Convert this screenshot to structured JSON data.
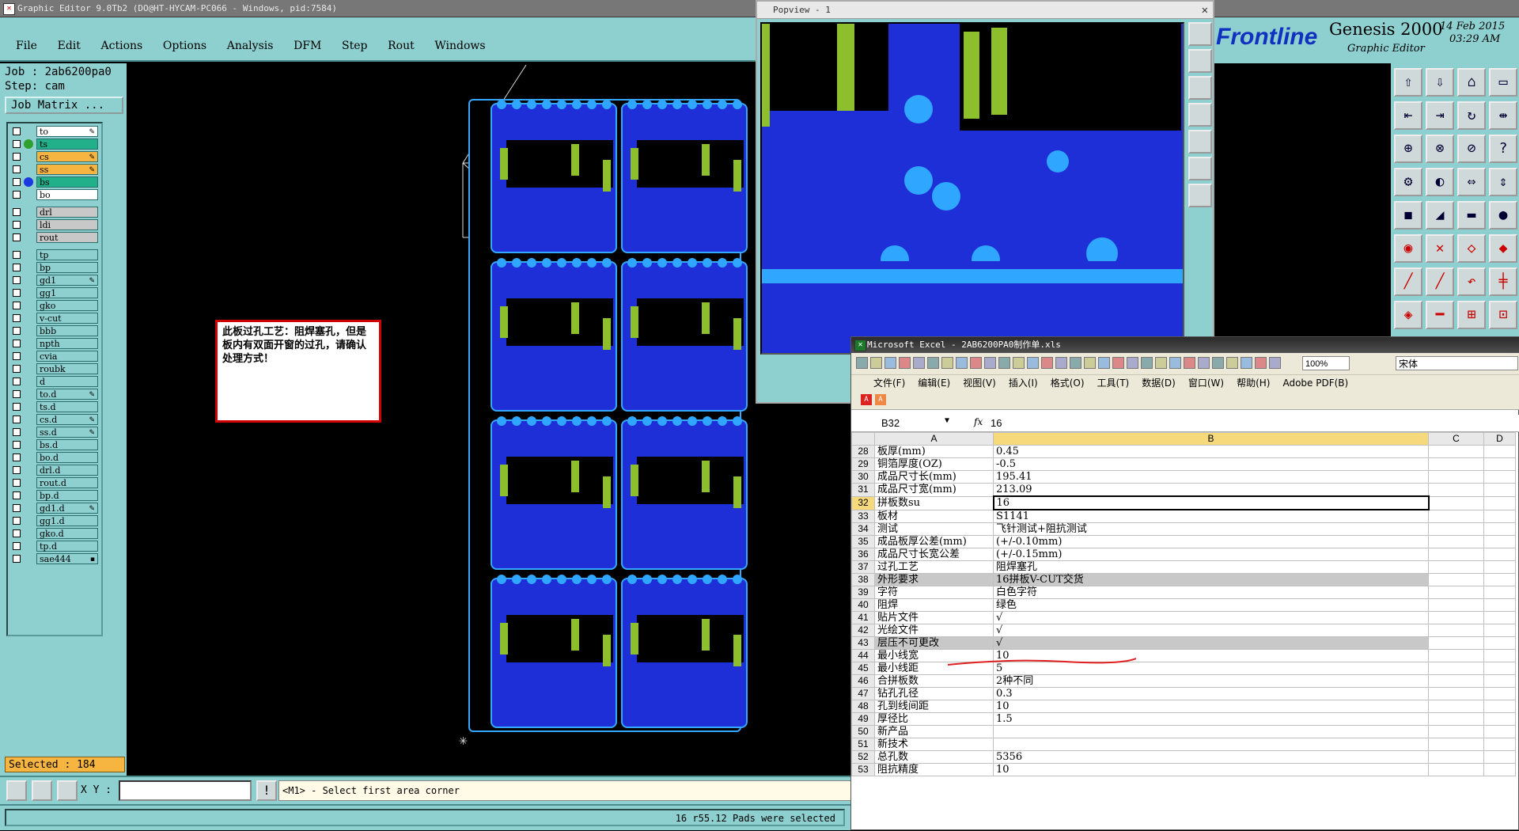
{
  "editor": {
    "title": "Graphic Editor 9.0Tb2 (DO@HT-HYCAM-PC066 - Windows, pid:7584)",
    "menu": [
      "File",
      "Edit",
      "Actions",
      "Options",
      "Analysis",
      "DFM",
      "Step",
      "Rout",
      "Windows"
    ],
    "job_label": "Job : 2ab6200pa0",
    "step_label": "Step: cam",
    "job_matrix_button": "Job Matrix ...",
    "layers": [
      {
        "name": "to",
        "color": "#ffffff",
        "dot": "",
        "mark": "✎"
      },
      {
        "name": "ts",
        "color": "#22b08a",
        "dot": "#2fa02f",
        "mark": ""
      },
      {
        "name": "cs",
        "color": "#f6b440",
        "dot": "",
        "mark": "✎"
      },
      {
        "name": "ss",
        "color": "#f6b440",
        "dot": "",
        "mark": "✎"
      },
      {
        "name": "bs",
        "color": "#22b08a",
        "dot": "#1a3ae0",
        "mark": ""
      },
      {
        "name": "bo",
        "color": "#ffffff",
        "dot": "",
        "mark": ""
      },
      {
        "name": "drl",
        "color": "#c8c8c8",
        "dot": "",
        "mark": "",
        "gap": true
      },
      {
        "name": "ldi",
        "color": "#c8c8c8",
        "dot": "",
        "mark": ""
      },
      {
        "name": "rout",
        "color": "#c8c8c8",
        "dot": "",
        "mark": ""
      },
      {
        "name": "tp",
        "color": "#8ecfcf",
        "dot": "",
        "mark": "",
        "gap": true
      },
      {
        "name": "bp",
        "color": "#8ecfcf",
        "dot": "",
        "mark": ""
      },
      {
        "name": "gd1",
        "color": "#8ecfcf",
        "dot": "",
        "mark": "✎"
      },
      {
        "name": "gg1",
        "color": "#8ecfcf",
        "dot": "",
        "mark": ""
      },
      {
        "name": "gko",
        "color": "#8ecfcf",
        "dot": "",
        "mark": ""
      },
      {
        "name": "v-cut",
        "color": "#8ecfcf",
        "dot": "",
        "mark": ""
      },
      {
        "name": "bbb",
        "color": "#8ecfcf",
        "dot": "",
        "mark": ""
      },
      {
        "name": "npth",
        "color": "#8ecfcf",
        "dot": "",
        "mark": ""
      },
      {
        "name": "cvia",
        "color": "#8ecfcf",
        "dot": "",
        "mark": ""
      },
      {
        "name": "roubk",
        "color": "#8ecfcf",
        "dot": "",
        "mark": ""
      },
      {
        "name": "d",
        "color": "#8ecfcf",
        "dot": "",
        "mark": ""
      },
      {
        "name": "to.d",
        "color": "#8ecfcf",
        "dot": "",
        "mark": "✎"
      },
      {
        "name": "ts.d",
        "color": "#8ecfcf",
        "dot": "",
        "mark": ""
      },
      {
        "name": "cs.d",
        "color": "#8ecfcf",
        "dot": "",
        "mark": "✎"
      },
      {
        "name": "ss.d",
        "color": "#8ecfcf",
        "dot": "",
        "mark": "✎"
      },
      {
        "name": "bs.d",
        "color": "#8ecfcf",
        "dot": "",
        "mark": ""
      },
      {
        "name": "bo.d",
        "color": "#8ecfcf",
        "dot": "",
        "mark": ""
      },
      {
        "name": "drl.d",
        "color": "#8ecfcf",
        "dot": "",
        "mark": ""
      },
      {
        "name": "rout.d",
        "color": "#8ecfcf",
        "dot": "",
        "mark": ""
      },
      {
        "name": "bp.d",
        "color": "#8ecfcf",
        "dot": "",
        "mark": ""
      },
      {
        "name": "gd1.d",
        "color": "#8ecfcf",
        "dot": "",
        "mark": "✎"
      },
      {
        "name": "gg1.d",
        "color": "#8ecfcf",
        "dot": "",
        "mark": ""
      },
      {
        "name": "gko.d",
        "color": "#8ecfcf",
        "dot": "",
        "mark": ""
      },
      {
        "name": "tp.d",
        "color": "#8ecfcf",
        "dot": "",
        "mark": ""
      },
      {
        "name": "sae444",
        "color": "#8ecfcf",
        "dot": "",
        "mark": "▪"
      }
    ],
    "selected_label": "Selected : 184",
    "xy_label": "X Y :",
    "xy_value": "",
    "prompt": "<M1> - Select first area corner",
    "status": "16 r55.12 Pads were selected",
    "note": "此板过孔工艺：阻焊塞孔，但是板内有双面开窗的过孔，请确认处理方式！"
  },
  "popview": {
    "title": "Popview - 1",
    "close": "✕"
  },
  "brand": {
    "logo": "Frontline",
    "product": "Genesis 2000",
    "subtitle": "Graphic Editor",
    "date": "14 Feb 2015",
    "time": "03:29 AM"
  },
  "excel": {
    "title": "Microsoft Excel - 2AB6200PA0制作单.xls",
    "zoom": "100%",
    "font": "宋体",
    "menu": [
      "文件(F)",
      "编辑(E)",
      "视图(V)",
      "插入(I)",
      "格式(O)",
      "工具(T)",
      "数据(D)",
      "窗口(W)",
      "帮助(H)",
      "Adobe PDF(B)"
    ],
    "cell_ref": "B32",
    "fx": "fx",
    "formula": "16",
    "col_headers": [
      "A",
      "B",
      "C",
      "D"
    ],
    "rows": [
      {
        "n": "28",
        "a": "板厚(mm)",
        "b": "0.45"
      },
      {
        "n": "29",
        "a": "铜箔厚度(OZ)",
        "b": "-0.5"
      },
      {
        "n": "30",
        "a": "成品尺寸长(mm)",
        "b": "195.41"
      },
      {
        "n": "31",
        "a": "成品尺寸宽(mm)",
        "b": "213.09"
      },
      {
        "n": "32",
        "a": "拼板数su",
        "b": "16",
        "selected": true
      },
      {
        "n": "33",
        "a": "板材",
        "b": "S1141"
      },
      {
        "n": "34",
        "a": "测试",
        "b": "飞针测试+阻抗测试"
      },
      {
        "n": "35",
        "a": "成品板厚公差(mm)",
        "b": "(+/-0.10mm)"
      },
      {
        "n": "36",
        "a": "成品尺寸长宽公差",
        "b": "(+/-0.15mm)"
      },
      {
        "n": "37",
        "a": "过孔工艺",
        "b": "阻焊塞孔"
      },
      {
        "n": "38",
        "a": "外形要求",
        "b": "16拼板V-CUT交货",
        "shade": true
      },
      {
        "n": "39",
        "a": "字符",
        "b": "白色字符"
      },
      {
        "n": "40",
        "a": "阻焊",
        "b": "绿色"
      },
      {
        "n": "41",
        "a": "贴片文件",
        "b": "√"
      },
      {
        "n": "42",
        "a": "光绘文件",
        "b": "√"
      },
      {
        "n": "43",
        "a": "层压不可更改",
        "b": "√",
        "shade": true
      },
      {
        "n": "44",
        "a": "最小线宽",
        "b": "10"
      },
      {
        "n": "45",
        "a": "最小线距",
        "b": "5"
      },
      {
        "n": "46",
        "a": "合拼板数",
        "b": "2种不同"
      },
      {
        "n": "47",
        "a": "钻孔孔径",
        "b": "0.3"
      },
      {
        "n": "48",
        "a": "孔到线间距",
        "b": "10"
      },
      {
        "n": "49",
        "a": "厚径比",
        "b": "1.5"
      },
      {
        "n": "50",
        "a": "新产品",
        "b": ""
      },
      {
        "n": "51",
        "a": "新技术",
        "b": ""
      },
      {
        "n": "52",
        "a": "总孔数",
        "b": "5356"
      },
      {
        "n": "53",
        "a": "阻抗精度",
        "b": "10"
      }
    ]
  },
  "colors": {
    "teal": "#8ecfcf",
    "pcb_blue": "#1f2fd8",
    "pad_blue": "#2fa6ff",
    "note_border": "#d00000"
  }
}
